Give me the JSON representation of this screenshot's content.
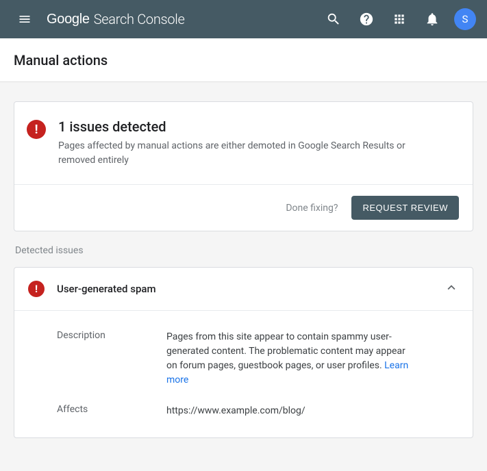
{
  "header": {
    "logo_primary": "Google",
    "logo_secondary": "Search Console",
    "avatar_initial": "S"
  },
  "page": {
    "title": "Manual actions"
  },
  "summary": {
    "heading": "1 issues detected",
    "description": "Pages affected by manual actions are either demoted in Google Search Results or removed entirely",
    "done_fixing_label": "Done fixing?",
    "request_review_label": "REQUEST REVIEW"
  },
  "section_label": "Detected issues",
  "issue": {
    "title": "User-generated spam",
    "fields": {
      "description_label": "Description",
      "description_value": "Pages from this site appear to contain spammy user-generated content. The problematic content may appear on forum pages, guestbook pages, or user profiles.",
      "learn_more_label": "Learn more",
      "affects_label": "Affects",
      "affects_value": "https://www.example.com/blog/"
    }
  }
}
